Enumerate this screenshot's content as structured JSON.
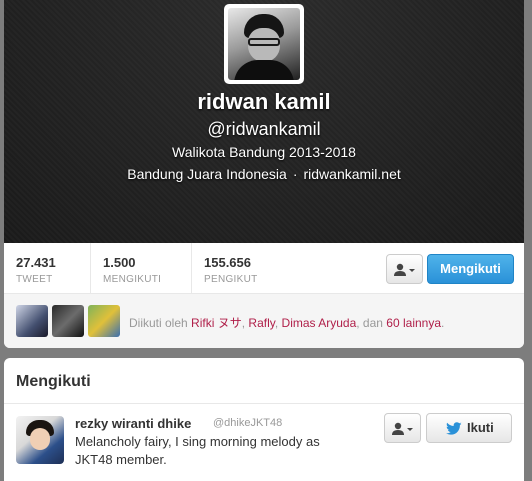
{
  "profile": {
    "name": "ridwan kamil",
    "handle": "@ridwankamil",
    "bio": "Walikota Bandung 2013-2018",
    "location": "Bandung Juara Indonesia",
    "separator": "·",
    "website": "ridwankamil.net"
  },
  "stats": [
    {
      "value": "27.431",
      "label": "TWEET"
    },
    {
      "value": "1.500",
      "label": "MENGIKUTI"
    },
    {
      "value": "155.656",
      "label": "PENGIKUT"
    }
  ],
  "actions": {
    "follow_label": "Mengikuti"
  },
  "followed_by": {
    "prefix": "Diikuti oleh",
    "names": [
      "Rifki ヌサ",
      "Rafly",
      "Dimas Aryuda"
    ],
    "comma": ",",
    "and": ", dan",
    "more": "60 lainnya",
    "period": "."
  },
  "following": {
    "title": "Mengikuti",
    "items": [
      {
        "name": "rezky wiranti dhike",
        "handle": "@dhikeJKT48",
        "bio": "Melancholy fairy, I sing morning melody as JKT48 member.",
        "follow_label": "Ikuti"
      }
    ]
  },
  "colors": {
    "accent": "#2a91d8",
    "link": "#b0204a"
  }
}
